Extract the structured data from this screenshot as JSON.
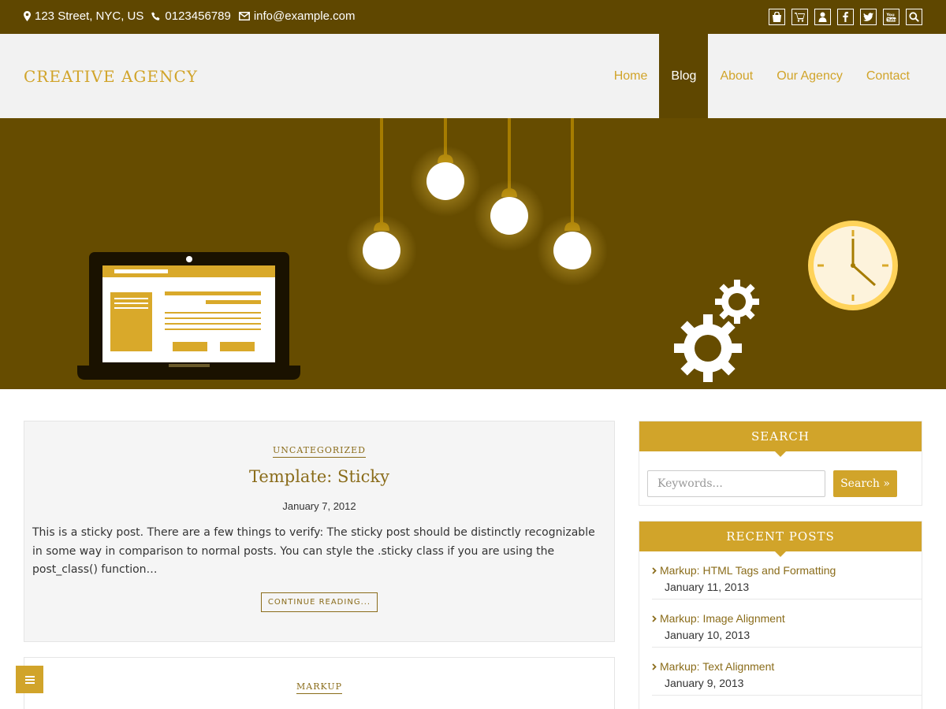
{
  "topbar": {
    "address": "123 Street, NYC, US",
    "phone": "0123456789",
    "email": "info@example.com",
    "social_icons": [
      "shopping-bag-icon",
      "cart-icon",
      "user-icon",
      "facebook-icon",
      "twitter-icon",
      "youtube-icon",
      "search-icon"
    ]
  },
  "header": {
    "brand": "CREATIVE AGENCY",
    "nav": [
      {
        "label": "Home",
        "active": false
      },
      {
        "label": "Blog",
        "active": true
      },
      {
        "label": "About",
        "active": false
      },
      {
        "label": "Our Agency",
        "active": false
      },
      {
        "label": "Contact",
        "active": false
      }
    ]
  },
  "posts": [
    {
      "category": "UNCATEGORIZED",
      "title": "Template: Sticky",
      "date": "January 7, 2012",
      "excerpt": "This is a sticky post. There are a few things to verify: The sticky post should be distinctly recognizable in some way in comparison to normal posts. You can style the .sticky class if you are using the post_class() function…",
      "more": "CONTINUE READING..."
    },
    {
      "category": "MARKUP"
    }
  ],
  "sidebar": {
    "search": {
      "title": "SEARCH",
      "placeholder": "Keywords...",
      "button": "Search »"
    },
    "recent": {
      "title": "RECENT POSTS",
      "items": [
        {
          "title": "Markup: HTML Tags and Formatting",
          "date": "January 11, 2013"
        },
        {
          "title": "Markup: Image Alignment",
          "date": "January 10, 2013"
        },
        {
          "title": "Markup: Text Alignment",
          "date": "January 9, 2013"
        }
      ]
    }
  },
  "colors": {
    "dark_brown": "#5f4700",
    "gold": "#d1a42a",
    "link": "#8a6c1a",
    "header_bg": "#f2f2f2"
  }
}
